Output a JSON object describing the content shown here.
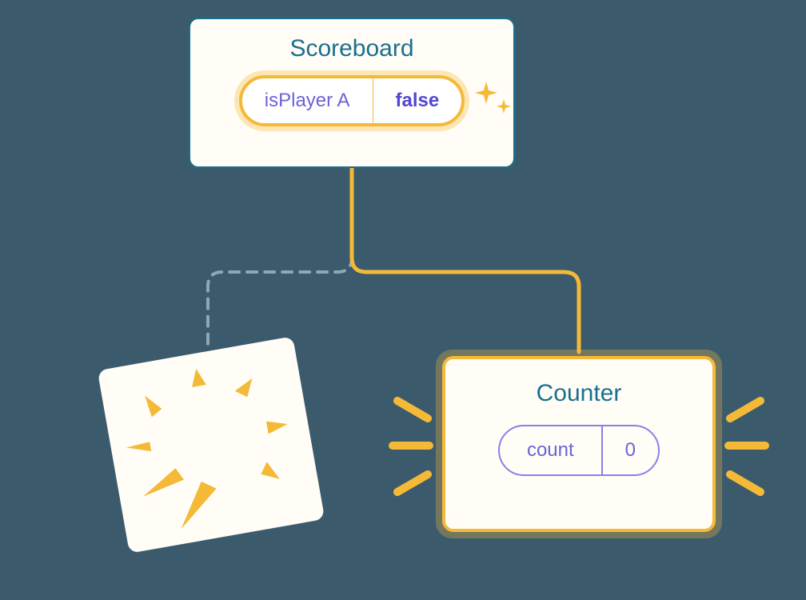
{
  "scoreboard": {
    "title": "Scoreboard",
    "prop_name": "isPlayer A",
    "prop_value": "false"
  },
  "counter": {
    "title": "Counter",
    "state_name": "count",
    "state_value": "0"
  },
  "colors": {
    "bg": "#3b5b6d",
    "card": "#fffdf6",
    "teal": "#1a6f8f",
    "accent": "#f5b938",
    "purple": "#6b63d6",
    "purple_bold": "#5246d4"
  }
}
